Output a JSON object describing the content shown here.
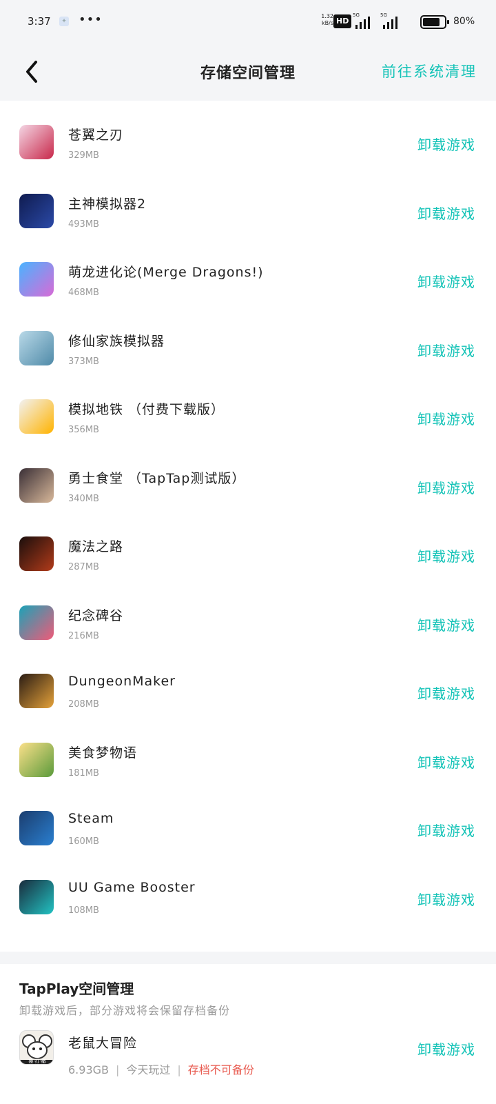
{
  "status_bar": {
    "time": "3:37",
    "dots": "•••",
    "net_speed": "1.32",
    "net_unit": "kB/s",
    "hd_label": "HD",
    "sig1_label": "5G",
    "sig2_label": "5G",
    "battery_pct": "80",
    "battery_level": 0.8
  },
  "nav": {
    "title": "存储空间管理",
    "action": "前往系统清理"
  },
  "games": [
    {
      "name": "苍翼之刃",
      "size": "329MB",
      "action": "卸载游戏",
      "icon": "red-anime-character-icon",
      "colors": [
        "#f4d6e4",
        "#c8284a"
      ]
    },
    {
      "name": "主神模拟器2",
      "size": "493MB",
      "action": "卸载游戏",
      "icon": "dark-blue-logo-icon",
      "colors": [
        "#0f1b4f",
        "#2b4aa8"
      ]
    },
    {
      "name": "萌龙进化论(Merge Dragons!)",
      "size": "468MB",
      "action": "卸载游戏",
      "icon": "pink-egg-icon",
      "colors": [
        "#4ab3ff",
        "#d86ad6"
      ]
    },
    {
      "name": "修仙家族模拟器",
      "size": "373MB",
      "action": "卸载游戏",
      "icon": "calligraphy-icon",
      "colors": [
        "#b9d9e8",
        "#4f8aa8"
      ]
    },
    {
      "name": "模拟地铁 （付费下载版）",
      "size": "356MB",
      "action": "卸载游戏",
      "icon": "metro-ring-icon",
      "colors": [
        "#f2f2f2",
        "#ffb300"
      ]
    },
    {
      "name": "勇士食堂 （TapTap测试版）",
      "size": "340MB",
      "action": "卸载游戏",
      "icon": "anime-girl-icon",
      "colors": [
        "#3a2f36",
        "#d8b89a"
      ]
    },
    {
      "name": "魔法之路",
      "size": "287MB",
      "action": "卸载游戏",
      "icon": "dark-mage-icon",
      "colors": [
        "#1a0e0c",
        "#b23b1a"
      ]
    },
    {
      "name": "纪念碑谷",
      "size": "216MB",
      "action": "卸载游戏",
      "icon": "monument-icon",
      "colors": [
        "#1aa3b8",
        "#f05a78"
      ]
    },
    {
      "name": "DungeonMaker",
      "size": "208MB",
      "action": "卸载游戏",
      "icon": "dungeon-character-icon",
      "colors": [
        "#2a1c14",
        "#e5a23a"
      ]
    },
    {
      "name": "美食梦物语",
      "size": "181MB",
      "action": "卸载游戏",
      "icon": "pixel-chef-icon",
      "colors": [
        "#fbe08a",
        "#5a9a3a"
      ]
    },
    {
      "name": "Steam",
      "size": "160MB",
      "action": "卸载游戏",
      "icon": "steam-logo-icon",
      "colors": [
        "#1b3d6e",
        "#2a7fd0"
      ]
    },
    {
      "name": "UU Game Booster",
      "size": "108MB",
      "action": "卸载游戏",
      "icon": "uu-booster-icon",
      "colors": [
        "#1a2b3c",
        "#22c3c3"
      ]
    }
  ],
  "tapplay": {
    "title": "TapPlay空间管理",
    "desc": "卸载游戏后，部分游戏将会保留存档备份",
    "game": {
      "name": "老鼠大冒险",
      "size": "6.93GB",
      "played": "今天玩过",
      "sep": "|",
      "warning": "存档不可备份",
      "action": "卸载游戏",
      "icon": "mouse-character-icon",
      "icon_label": "搜·打·撤"
    }
  },
  "colors": {
    "accent": "#14c3b7",
    "warning": "#e85a4f",
    "header_bg": "#f4f5f7"
  }
}
